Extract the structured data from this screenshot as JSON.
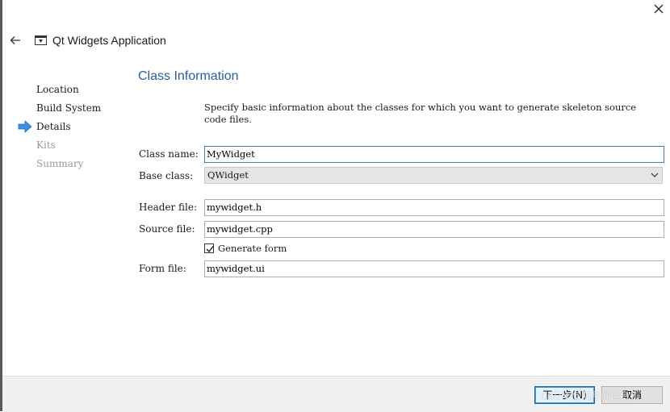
{
  "header": {
    "title": "Qt Widgets Application",
    "back_icon": "arrow-left-icon",
    "app_icon": "window-icon",
    "close_icon": "close-icon"
  },
  "steps": [
    {
      "label": "Location",
      "state": "done"
    },
    {
      "label": "Build System",
      "state": "done"
    },
    {
      "label": "Details",
      "state": "current"
    },
    {
      "label": "Kits",
      "state": "disabled"
    },
    {
      "label": "Summary",
      "state": "disabled"
    }
  ],
  "page": {
    "section_title": "Class Information",
    "description": "Specify basic information about the classes for which you want to generate skeleton source code files."
  },
  "form": {
    "class_name_label": "Class name:",
    "class_name_value": "MyWidget",
    "base_class_label": "Base class:",
    "base_class_value": "QWidget",
    "header_file_label": "Header file:",
    "header_file_value": "mywidget.h",
    "source_file_label": "Source file:",
    "source_file_value": "mywidget.cpp",
    "generate_form_label": "Generate form",
    "generate_form_checked": true,
    "form_file_label": "Form file:",
    "form_file_value": "mywidget.ui"
  },
  "footer": {
    "next_label": "下一步(N)",
    "cancel_label": "取消",
    "watermark": "CSDN @明月醉窗台"
  },
  "colors": {
    "accent": "#2b5aa8",
    "focus_border": "#3c7fb1",
    "current_step_arrow": "#3d8ee0"
  }
}
